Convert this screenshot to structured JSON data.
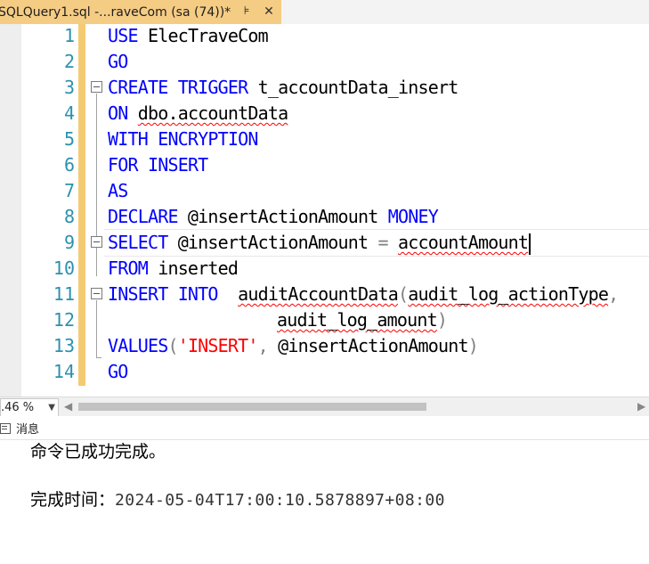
{
  "tab": {
    "title": "SQLQuery1.sql -...raveCom (sa (74))*",
    "pin_glyph": "⊧",
    "close_glyph": "✕"
  },
  "editor": {
    "line_numbers": [
      "1",
      "2",
      "3",
      "4",
      "5",
      "6",
      "7",
      "8",
      "9",
      "10",
      "11",
      "12",
      "13",
      "14"
    ],
    "lines": {
      "l1_use": "USE",
      "l1_db": " ElecTraveCom",
      "l2_go": "GO",
      "l3_create": "CREATE",
      "l3_trigger": " TRIGGER",
      "l3_name": " t_accountData_insert",
      "l4_on": "ON",
      "l4_table": "dbo.accountData",
      "l5_with": "WITH",
      "l5_encryption": " ENCRYPTION",
      "l6_for": "FOR",
      "l6_insert": " INSERT",
      "l7_as": "AS",
      "l8_declare": "DECLARE",
      "l8_var": " @insertActionAmount ",
      "l8_type": "MONEY",
      "l9_select": "SELECT",
      "l9_var": " @insertActionAmount ",
      "l9_eq": "=",
      "l9_col": "accountAmount",
      "l10_from": "FROM",
      "l10_table": " inserted",
      "l11_insert": "INSERT",
      "l11_into": " INTO",
      "l11_table": "auditAccountData",
      "l11_paren": "(",
      "l11_col1": "audit_log_actionType",
      "l11_comma": ",",
      "l12_col2": "audit_log_amount",
      "l12_paren": ")",
      "l13_values": "VALUES",
      "l13_open": "(",
      "l13_str": "'INSERT'",
      "l13_comma": ",",
      "l13_var": " @insertActionAmount",
      "l13_close": ")",
      "l14_go": "GO"
    }
  },
  "status": {
    "zoom": ".46 %"
  },
  "messages": {
    "tab_label": "消息",
    "line1": "命令已成功完成。",
    "completion_label": "完成时间：",
    "completion_time": "2024-05-04T17:00:10.5878897+08:00"
  }
}
